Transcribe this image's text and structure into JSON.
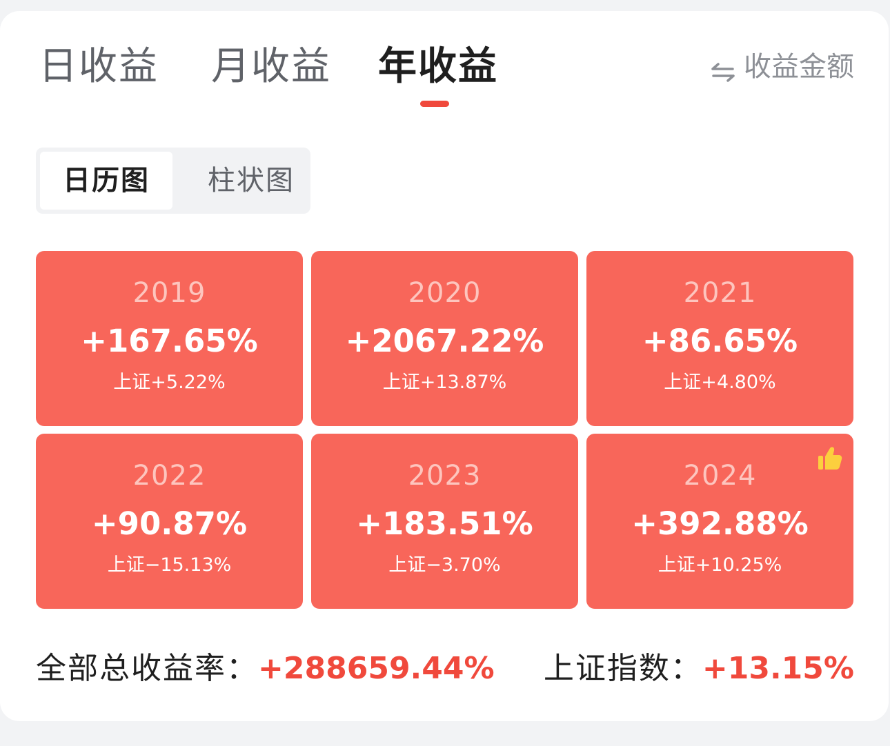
{
  "tabs": [
    {
      "label": "日收益",
      "active": false
    },
    {
      "label": "月收益",
      "active": false
    },
    {
      "label": "年收益",
      "active": true
    }
  ],
  "amount_toggle": {
    "label": "收益金额",
    "icon": "swap-arrows-icon"
  },
  "view_switch": [
    {
      "label": "日历图",
      "active": true
    },
    {
      "label": "柱状图",
      "active": false
    }
  ],
  "years": [
    {
      "year": "2019",
      "return": "+167.65%",
      "index": "上证+5.22%"
    },
    {
      "year": "2020",
      "return": "+2067.22%",
      "index": "上证+13.87%"
    },
    {
      "year": "2021",
      "return": "+86.65%",
      "index": "上证+4.80%"
    },
    {
      "year": "2022",
      "return": "+90.87%",
      "index": "上证−15.13%"
    },
    {
      "year": "2023",
      "return": "+183.51%",
      "index": "上证−3.70%"
    },
    {
      "year": "2024",
      "return": "+392.88%",
      "index": "上证+10.25%",
      "badge_icon": "thumbs-up-icon"
    }
  ],
  "summary": {
    "total_label": "全部总收益率：",
    "total_value": "+288659.44%",
    "index_label": "上证指数：",
    "index_value": "+13.15%"
  },
  "colors": {
    "accent": "#f0493c",
    "tile": "#f8665a",
    "badge": "#fccf3e"
  }
}
